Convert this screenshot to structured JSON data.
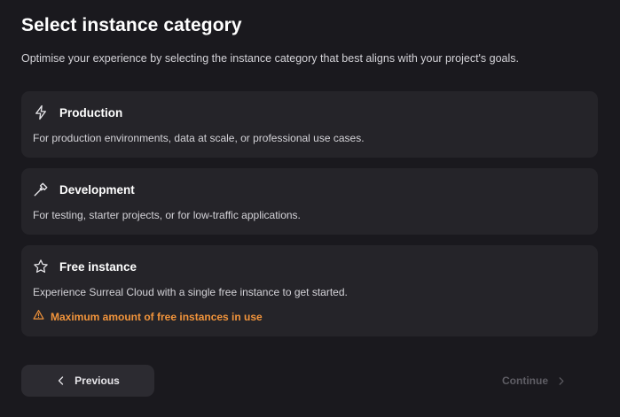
{
  "header": {
    "title": "Select instance category",
    "subtitle": "Optimise your experience by selecting the instance category that best aligns with your project's goals."
  },
  "categories": [
    {
      "icon": "lightning-icon",
      "title": "Production",
      "description": "For production environments, data at scale, or professional use cases."
    },
    {
      "icon": "hammer-icon",
      "title": "Development",
      "description": "For testing, starter projects, or for low-traffic applications."
    },
    {
      "icon": "star-icon",
      "title": "Free instance",
      "description": "Experience Surreal Cloud with a single free instance to get started.",
      "warning": "Maximum amount of free instances in use"
    }
  ],
  "footer": {
    "previous_label": "Previous",
    "continue_label": "Continue"
  },
  "colors": {
    "background": "#1a191e",
    "card": "#252429",
    "warning": "#f2943b",
    "disabled_text": "#5f5e65"
  }
}
